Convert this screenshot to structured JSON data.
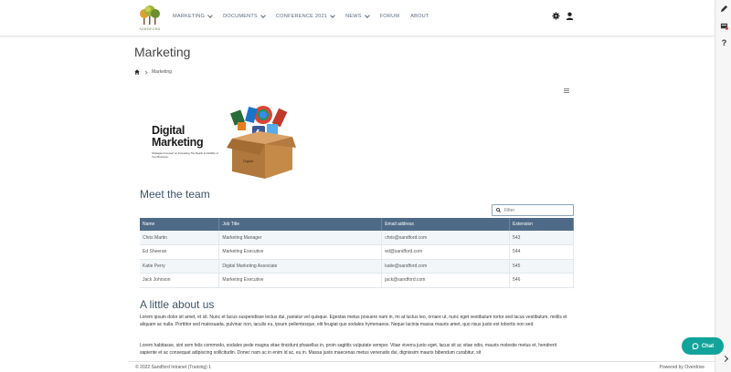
{
  "logo": {
    "text": "SANDFORD"
  },
  "nav": [
    {
      "label": "MARKETING",
      "dropdown": true
    },
    {
      "label": "DOCUMENTS",
      "dropdown": true
    },
    {
      "label": "CONFERENCE 2021",
      "dropdown": true
    },
    {
      "label": "NEWS",
      "dropdown": true
    },
    {
      "label": "FORUM",
      "dropdown": false
    },
    {
      "label": "ABOUT",
      "dropdown": false
    }
  ],
  "page": {
    "title": "Marketing"
  },
  "breadcrumb": {
    "current": "Marketing"
  },
  "banner": {
    "title_line1": "Digital",
    "title_line2": "Marketing",
    "subtitle": "Strategies Focused on Increasing The Reach & Visibility of Your Business."
  },
  "team": {
    "heading": "Meet the team",
    "filter_placeholder": "Filter",
    "columns": [
      "Name",
      "Job Title",
      "Email address",
      "Extension"
    ],
    "rows": [
      [
        "Chris Martin",
        "Marketing Manager",
        "chris@sandford.com",
        "543"
      ],
      [
        "Ed Sheeran",
        "Marketing Executive",
        "ed@sandford.com",
        "544"
      ],
      [
        "Katie Perry",
        "Digital Marketing Associate",
        "katie@sandford.com",
        "545"
      ],
      [
        "Jack Johnson",
        "Marketing Executive",
        "jack@sandford.com",
        "546"
      ]
    ]
  },
  "about": {
    "heading": "A little about us",
    "p1": "Lorem ipsum dolor sit amet, et sit. Nunc et lacus suspendisse lectus dui, pariatur vel quisque. Egestas metus posuere nam in, mi at luctus leo, ornare ut, nunc eget vestibulum tortor sed lacus vestibulum, mollis et aliquam ac nulla. Porttitor sed malesuada, pulvinar non, iaculis eu, ipsum pellentesque, elit feugiat quo sodales hymenaeos. Neque lacinia massa mauris amet, quo risus justo est lobortis non sed.",
    "p2": "Lorem habitasse, sint sem felis commodo, sodales pede magna vitae tincidunt phasellus in, proin sagittis vulputate semper. Vitae viverra justo eget, lacus sit ac vitae odio, mauris molestie metus et, hendrerit sapiente et ac consequat adipiscing sollicitudin. Donec nam ac in enim id ac, eu in. Massa justo maecenas metus venenatis dui, dignissim mauris bibendum curabitur, sit"
  },
  "footer": {
    "left": "© 2022 Sandford Intranet (Training) 1",
    "right": "Powered by Overdrive"
  },
  "chat": {
    "label": "Chat"
  },
  "colors": {
    "header_row": "#4e6a86",
    "chat": "#12a39a",
    "heading": "#3e5468"
  }
}
